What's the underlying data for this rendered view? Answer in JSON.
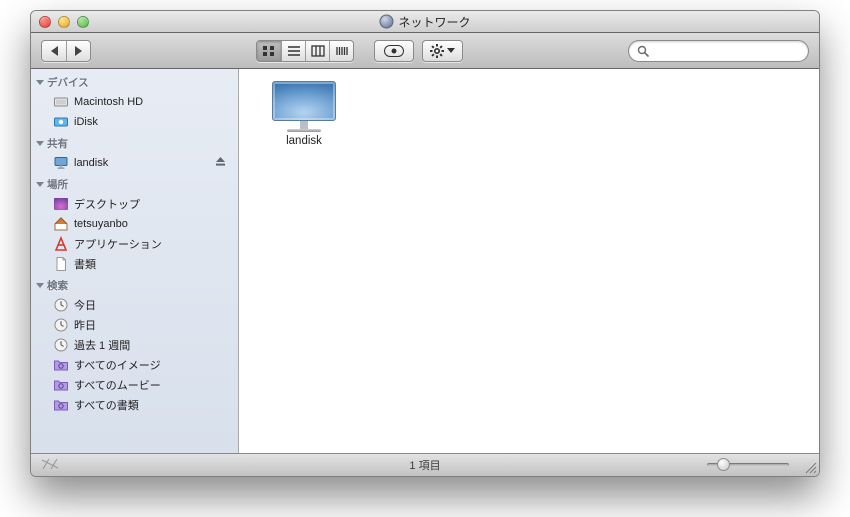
{
  "window": {
    "title": "ネットワーク"
  },
  "toolbar": {
    "search_placeholder": ""
  },
  "sidebar": {
    "devices": {
      "label": "デバイス",
      "items": [
        {
          "label": "Macintosh HD"
        },
        {
          "label": "iDisk"
        }
      ]
    },
    "shared": {
      "label": "共有",
      "items": [
        {
          "label": "landisk",
          "ejectable": true
        }
      ]
    },
    "places": {
      "label": "場所",
      "items": [
        {
          "label": "デスクトップ"
        },
        {
          "label": "tetsuyanbo"
        },
        {
          "label": "アプリケーション"
        },
        {
          "label": "書類"
        }
      ]
    },
    "search": {
      "label": "検索",
      "items": [
        {
          "label": "今日"
        },
        {
          "label": "昨日"
        },
        {
          "label": "過去 1 週間"
        },
        {
          "label": "すべてのイメージ"
        },
        {
          "label": "すべてのムービー"
        },
        {
          "label": "すべての書類"
        }
      ]
    }
  },
  "content": {
    "items": [
      {
        "label": "landisk"
      }
    ]
  },
  "status": {
    "count_text": "1 項目"
  }
}
